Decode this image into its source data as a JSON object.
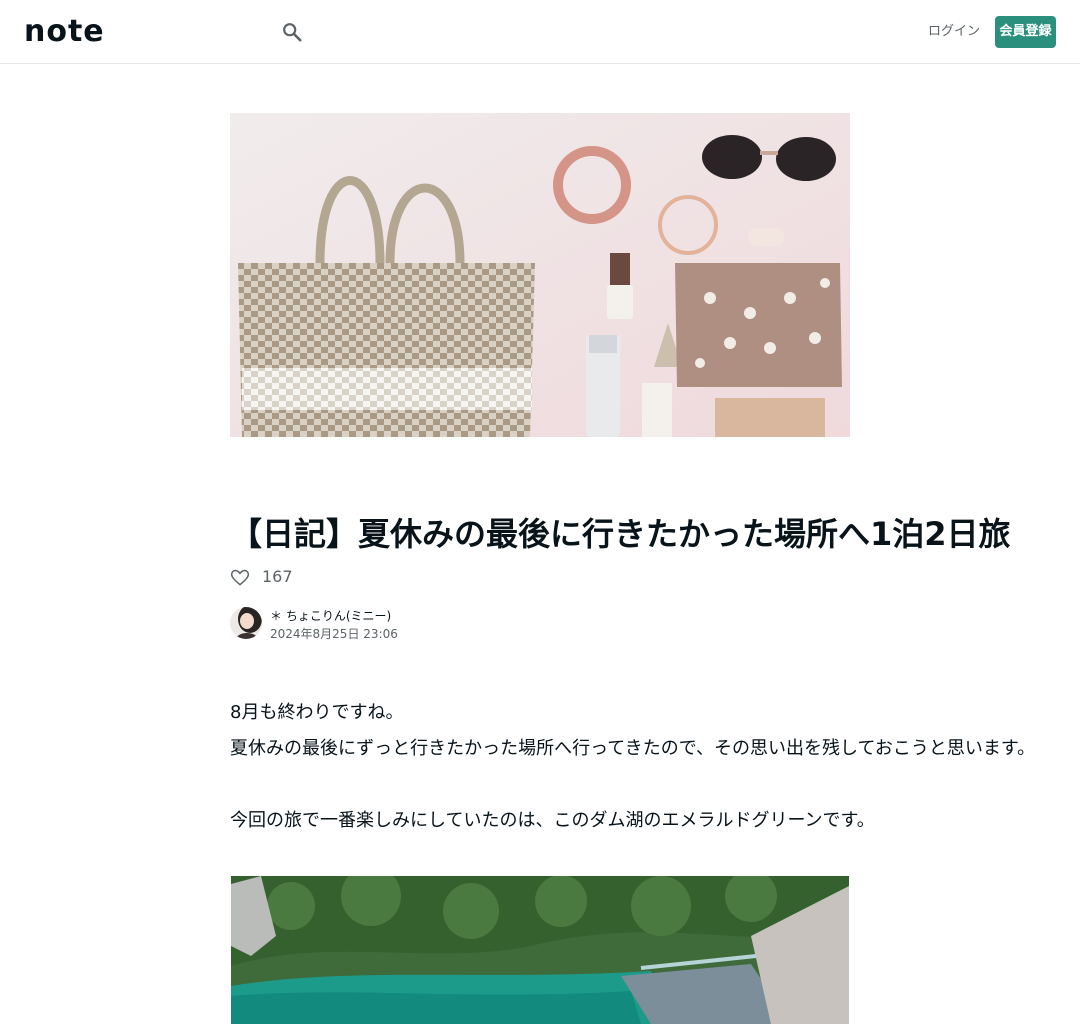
{
  "header": {
    "logo": "note",
    "login_label": "ログイン",
    "signup_label": "会員登録",
    "accent_color": "#2a8f7c"
  },
  "article": {
    "title": "【日記】夏休みの最後に行きたかった場所へ1泊2日旅",
    "likes": "167",
    "author": "＊ ちょこりん(ミニー)",
    "date": "2024年8月25日 23:06",
    "paragraphs": [
      "8月も終わりですね。",
      "夏休みの最後にずっと行きたかった場所へ行ってきたので、その思い出を残しておこうと思います。",
      "今回の旅で一番楽しみにしていたのは、このダム湖のエメラルドグリーンです。"
    ]
  },
  "icons": {
    "search": "search-icon",
    "like": "heart-icon"
  }
}
